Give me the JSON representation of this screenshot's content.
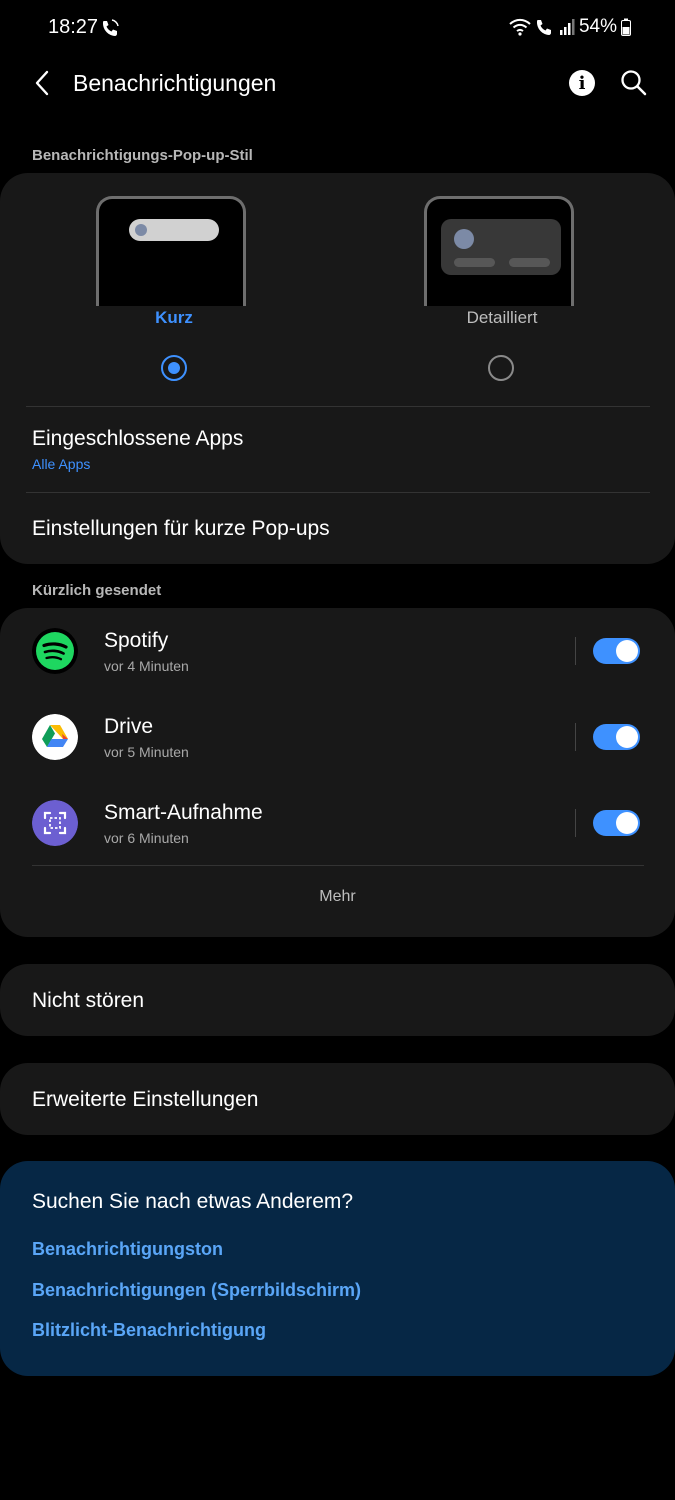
{
  "status": {
    "time": "18:27",
    "battery": "54%"
  },
  "header": {
    "title": "Benachrichtigungen"
  },
  "popup_style": {
    "section_label": "Benachrichtigungs-Pop-up-Stil",
    "options": [
      {
        "label": "Kurz",
        "selected": true
      },
      {
        "label": "Detailliert",
        "selected": false
      }
    ],
    "included_apps_title": "Eingeschlossene Apps",
    "included_apps_value": "Alle Apps",
    "brief_settings_title": "Einstellungen für kurze Pop-ups"
  },
  "recent": {
    "section_label": "Kürzlich gesendet",
    "apps": [
      {
        "name": "Spotify",
        "time": "vor 4 Minuten",
        "icon": "spotify-icon",
        "enabled": true
      },
      {
        "name": "Drive",
        "time": "vor 5 Minuten",
        "icon": "drive-icon",
        "enabled": true
      },
      {
        "name": "Smart-Aufnahme",
        "time": "vor 6 Minuten",
        "icon": "smart-capture-icon",
        "enabled": true
      }
    ],
    "more_label": "Mehr"
  },
  "do_not_disturb": "Nicht stören",
  "advanced_settings": "Erweiterte Einstellungen",
  "suggestions": {
    "title": "Suchen Sie nach etwas Anderem?",
    "links": [
      "Benachrichtigungston",
      "Benachrichtigungen (Sperrbildschirm)",
      "Blitzlicht-Benachrichtigung"
    ]
  },
  "colors": {
    "accent": "#3e91ff",
    "card": "#181818",
    "suggest_bg": "#062745",
    "link": "#5aa6f7"
  }
}
